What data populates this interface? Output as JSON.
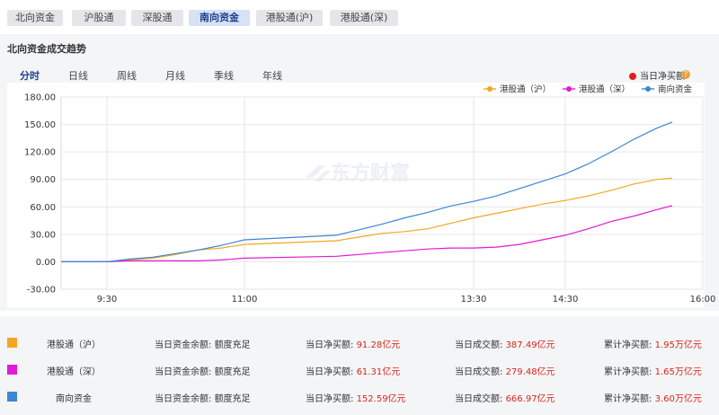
{
  "top_tabs": [
    "北向资金",
    "沪股通",
    "深股通",
    "南向资金",
    "港股通(沪)",
    "港股通(深)"
  ],
  "active_top_tab": "南向资金",
  "panel": {
    "title": "北向资金成交趋势",
    "period_tabs": [
      "分时",
      "日线",
      "周线",
      "月线",
      "季线",
      "年线"
    ],
    "active_period": "分时",
    "net_buy_label": "当日净买额",
    "help_icon": "?"
  },
  "colors": {
    "hk_sh": "#f5a623",
    "hk_sz": "#e21ad4",
    "southbound": "#3b86d6",
    "accent": "#1f3f8f",
    "value_red": "#d9261c"
  },
  "chart_data": {
    "type": "line",
    "x_ticks": [
      "9:30",
      "11:00",
      "13:30",
      "14:30",
      "16:00"
    ],
    "x_range": [
      "09:00",
      "16:00"
    ],
    "y_ticks": [
      "180.00",
      "150.00",
      "120.00",
      "90.00",
      "60.00",
      "30.00",
      "0.00",
      "-30.00"
    ],
    "ylim": [
      -30,
      180
    ],
    "grid": true,
    "legend_position": "top-right",
    "series": [
      {
        "name": "港股通（沪）",
        "color": "#f5a623",
        "points": [
          [
            "09:00",
            0
          ],
          [
            "09:15",
            0
          ],
          [
            "09:30",
            0
          ],
          [
            "09:45",
            2
          ],
          [
            "10:00",
            4
          ],
          [
            "10:15",
            8
          ],
          [
            "10:30",
            13
          ],
          [
            "10:45",
            15
          ],
          [
            "11:00",
            19
          ],
          [
            "12:00",
            23
          ],
          [
            "12:15",
            27
          ],
          [
            "12:30",
            31
          ],
          [
            "12:45",
            33
          ],
          [
            "13:00",
            36
          ],
          [
            "13:15",
            42
          ],
          [
            "13:30",
            48
          ],
          [
            "13:45",
            53
          ],
          [
            "14:00",
            58
          ],
          [
            "14:15",
            63
          ],
          [
            "14:30",
            67
          ],
          [
            "14:45",
            72
          ],
          [
            "15:00",
            78
          ],
          [
            "15:15",
            85
          ],
          [
            "15:30",
            90
          ],
          [
            "15:40",
            91.28
          ]
        ]
      },
      {
        "name": "港股通（深）",
        "color": "#e21ad4",
        "points": [
          [
            "09:00",
            0
          ],
          [
            "09:15",
            0
          ],
          [
            "09:30",
            0
          ],
          [
            "09:45",
            1
          ],
          [
            "10:00",
            1
          ],
          [
            "10:15",
            1
          ],
          [
            "10:30",
            1
          ],
          [
            "10:45",
            2
          ],
          [
            "11:00",
            4
          ],
          [
            "12:00",
            6
          ],
          [
            "12:15",
            8
          ],
          [
            "12:30",
            10
          ],
          [
            "12:45",
            12
          ],
          [
            "13:00",
            14
          ],
          [
            "13:15",
            15
          ],
          [
            "13:30",
            15
          ],
          [
            "13:45",
            16
          ],
          [
            "14:00",
            19
          ],
          [
            "14:15",
            24
          ],
          [
            "14:30",
            29
          ],
          [
            "14:45",
            36
          ],
          [
            "15:00",
            44
          ],
          [
            "15:15",
            50
          ],
          [
            "15:30",
            57
          ],
          [
            "15:40",
            61.31
          ]
        ]
      },
      {
        "name": "南向资金",
        "color": "#3b86d6",
        "points": [
          [
            "09:00",
            0
          ],
          [
            "09:15",
            0
          ],
          [
            "09:30",
            0
          ],
          [
            "09:45",
            3
          ],
          [
            "10:00",
            5
          ],
          [
            "10:15",
            9
          ],
          [
            "10:30",
            13
          ],
          [
            "10:45",
            18
          ],
          [
            "11:00",
            24
          ],
          [
            "12:00",
            29
          ],
          [
            "12:15",
            35
          ],
          [
            "12:30",
            41
          ],
          [
            "12:45",
            48
          ],
          [
            "13:00",
            54
          ],
          [
            "13:15",
            61
          ],
          [
            "13:30",
            66
          ],
          [
            "13:45",
            72
          ],
          [
            "14:00",
            80
          ],
          [
            "14:15",
            88
          ],
          [
            "14:30",
            96
          ],
          [
            "14:45",
            107
          ],
          [
            "15:00",
            120
          ],
          [
            "15:15",
            134
          ],
          [
            "15:30",
            146
          ],
          [
            "15:40",
            152.59
          ]
        ]
      }
    ]
  },
  "summary_rows": [
    {
      "name": "港股通（沪）",
      "color": "#f5a623",
      "balance_label": "当日资金余额:",
      "balance_value": "额度充足",
      "net_buy_label": "当日净买额:",
      "net_buy_value": "91.28亿元",
      "turnover_label": "当日成交额:",
      "turnover_value": "387.49亿元",
      "cum_label": "累计净买额:",
      "cum_value": "1.95万亿元"
    },
    {
      "name": "港股通（深）",
      "color": "#e21ad4",
      "balance_label": "当日资金余额:",
      "balance_value": "额度充足",
      "net_buy_label": "当日净买额:",
      "net_buy_value": "61.31亿元",
      "turnover_label": "当日成交额:",
      "turnover_value": "279.48亿元",
      "cum_label": "累计净买额:",
      "cum_value": "1.65万亿元"
    },
    {
      "name": "南向资金",
      "color": "#3b86d6",
      "balance_label": "当日资金余额:",
      "balance_value": "额度充足",
      "net_buy_label": "当日净买额:",
      "net_buy_value": "152.59亿元",
      "turnover_label": "当日成交额:",
      "turnover_value": "666.97亿元",
      "cum_label": "累计净买额:",
      "cum_value": "3.60万亿元"
    }
  ]
}
